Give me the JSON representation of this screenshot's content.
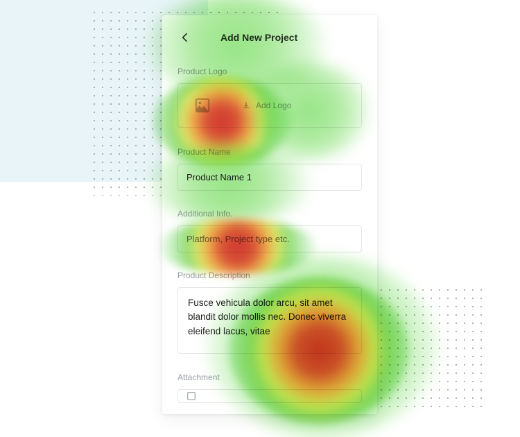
{
  "header": {
    "title": "Add New Project"
  },
  "sections": {
    "logo": {
      "label": "Product Logo",
      "add_label": "Add Logo"
    },
    "name": {
      "label": "Product Name",
      "value": "Product Name 1"
    },
    "additional": {
      "label": "Additional Info.",
      "placeholder": "Platform, Project type etc."
    },
    "description": {
      "label": "Product Description",
      "value": "Fusce vehicula dolor arcu, sit amet blandit dolor mollis nec. Donec viverra eleifend lacus, vitae"
    },
    "attachment": {
      "label": "Attachment"
    }
  }
}
